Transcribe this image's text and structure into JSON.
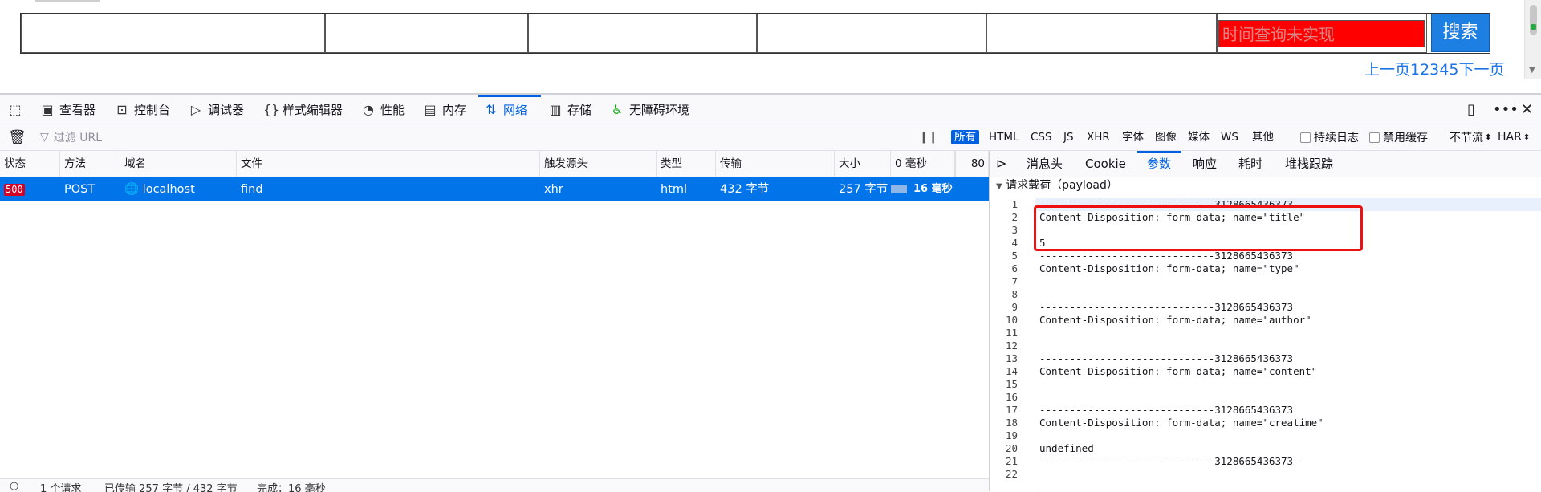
{
  "webpage": {
    "time_placeholder": "时间查询未实现",
    "search_label": "搜索",
    "pager_text": "上一页12345下一页"
  },
  "devtools": {
    "tools": [
      {
        "name": "picker",
        "label": "",
        "icon": "element-picker-icon"
      },
      {
        "name": "inspector",
        "label": "查看器",
        "icon": "inspector-icon"
      },
      {
        "name": "console",
        "label": "控制台",
        "icon": "console-icon"
      },
      {
        "name": "debugger",
        "label": "调试器",
        "icon": "debugger-icon"
      },
      {
        "name": "style-editor",
        "label": "样式编辑器",
        "icon": "braces-icon"
      },
      {
        "name": "performance",
        "label": "性能",
        "icon": "gauge-icon"
      },
      {
        "name": "memory",
        "label": "内存",
        "icon": "chip-icon"
      },
      {
        "name": "network",
        "label": "网络",
        "icon": "arrows-updown-icon",
        "selected": true
      },
      {
        "name": "storage",
        "label": "存储",
        "icon": "storage-icon"
      },
      {
        "name": "accessibility",
        "label": "无障碍环境",
        "icon": "accessibility-icon"
      }
    ],
    "filter_placeholder": "过滤 URL",
    "type_filters": [
      "所有",
      "HTML",
      "CSS",
      "JS",
      "XHR",
      "字体",
      "图像",
      "媒体",
      "WS",
      "其他"
    ],
    "persist_logs": "持续日志",
    "disable_cache": "禁用缓存",
    "throttle": "不节流",
    "har": "HAR",
    "columns": [
      "状态",
      "方法",
      "域名",
      "文件",
      "触发源头",
      "类型",
      "传输",
      "大小",
      "0 毫秒"
    ],
    "waterfall_tick": "80",
    "request": {
      "status": "500",
      "method": "POST",
      "domain": "localhost",
      "file": "find",
      "initiator": "xhr",
      "type": "html",
      "transferred": "432 字节",
      "size": "257 字节",
      "time": "16 毫秒"
    },
    "detail_tabs": [
      "消息头",
      "Cookie",
      "参数",
      "响应",
      "耗时",
      "堆栈跟踪"
    ],
    "selected_detail_tab": "参数",
    "payload_title": "请求载荷（payload）",
    "payload_lines": [
      "-----------------------------3128665436373",
      "Content-Disposition: form-data; name=\"title\"",
      "",
      "5",
      "-----------------------------3128665436373",
      "Content-Disposition: form-data; name=\"type\"",
      "",
      "",
      "-----------------------------3128665436373",
      "Content-Disposition: form-data; name=\"author\"",
      "",
      "",
      "-----------------------------3128665436373",
      "Content-Disposition: form-data; name=\"content\"",
      "",
      "",
      "-----------------------------3128665436373",
      "Content-Disposition: form-data; name=\"creatime\"",
      "",
      "undefined",
      "-----------------------------3128665436373--",
      ""
    ],
    "statusbar": {
      "requests": "1 个请求",
      "transferred": "已传输 257 字节 / 432 字节",
      "finish": "完成：16 毫秒"
    }
  }
}
